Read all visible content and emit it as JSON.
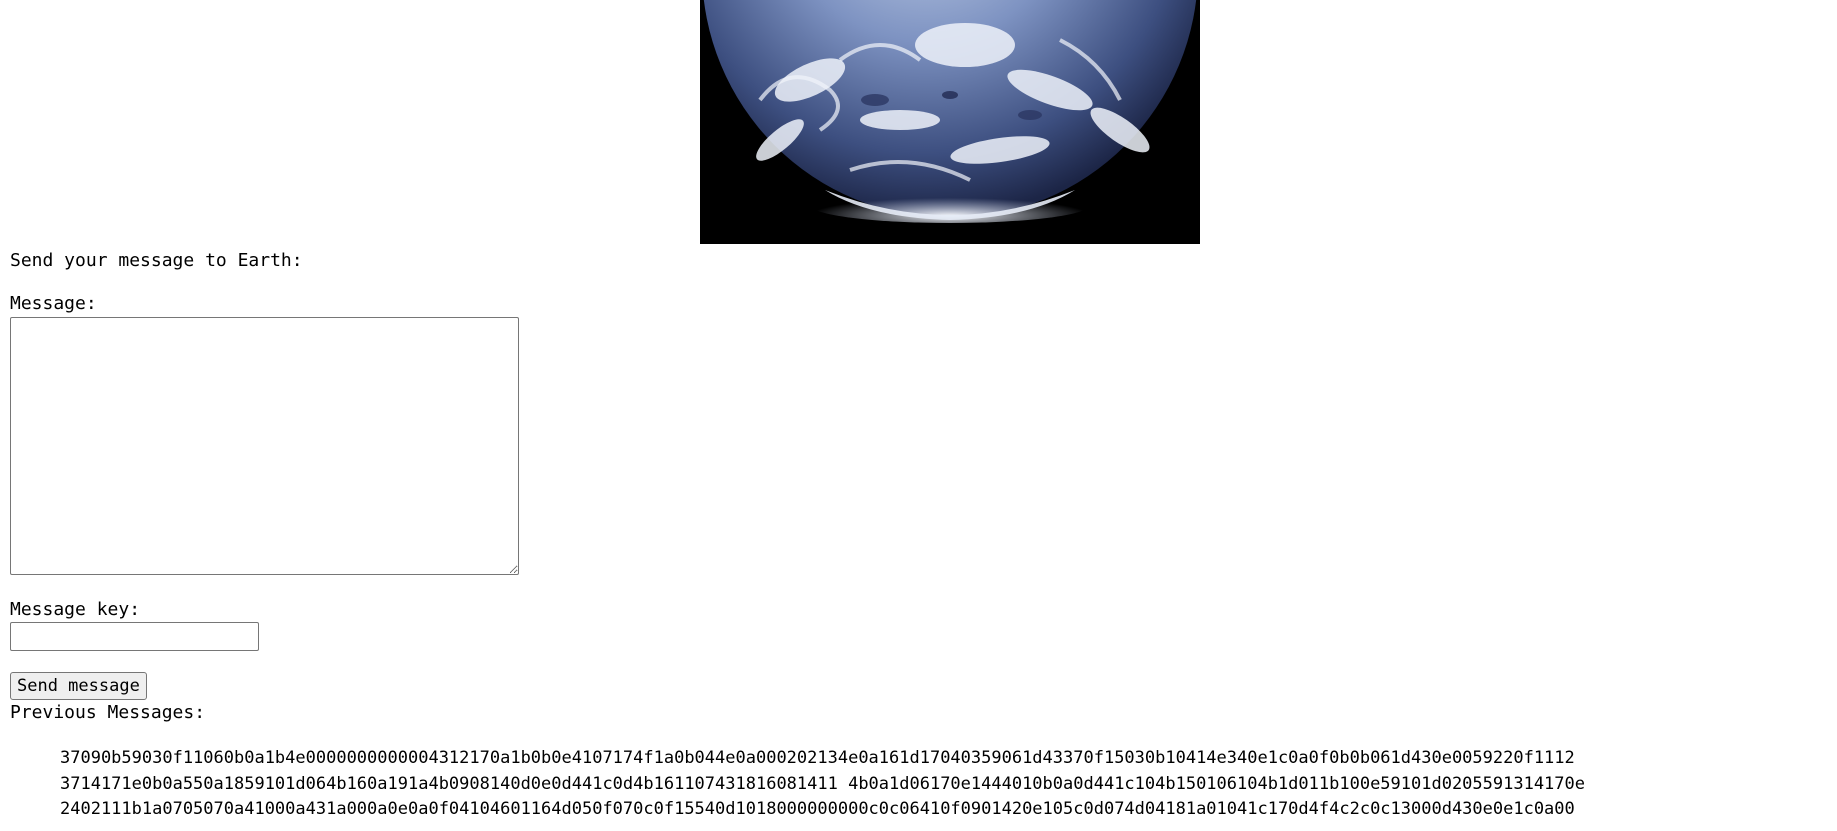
{
  "image": {
    "alt": "Earth",
    "background_color": "#000000",
    "description_icon": "earth-globe-image"
  },
  "form": {
    "intro_text": "Send your message to Earth:",
    "message_label": "Message:",
    "message_value": "",
    "key_label": "Message key:",
    "key_value": "",
    "send_button_label": "Send message"
  },
  "previous": {
    "heading": "Previous Messages:",
    "messages": [
      "37090b59030f11060b0a1b4e0000000000004312170a1b0b0e4107174f1a0b044e0a000202134e0a161d17040359061d43370f15030b10414e340e1c0a0f0b0b061d430e0059220f1112",
      "3714171e0b0a550a1859101d064b160a191a4b0908140d0e0d441c0d4b161107431816081411 4b0a1d06170e1444010b0a0d441c104b150106104b1d011b100e59101d0205591314170e",
      "2402111b1a0705070a41000a431a000a0e0a0f04104601164d050f070c0f15540d1018000000000c0c06410f0901420e105c0d074d04181a01041c170d4f4c2c0c13000d430e0e1c0a00"
    ]
  },
  "colors": {
    "page_background": "#ffffff",
    "text": "#000000",
    "control_border": "#767676",
    "button_background": "#efefef"
  }
}
